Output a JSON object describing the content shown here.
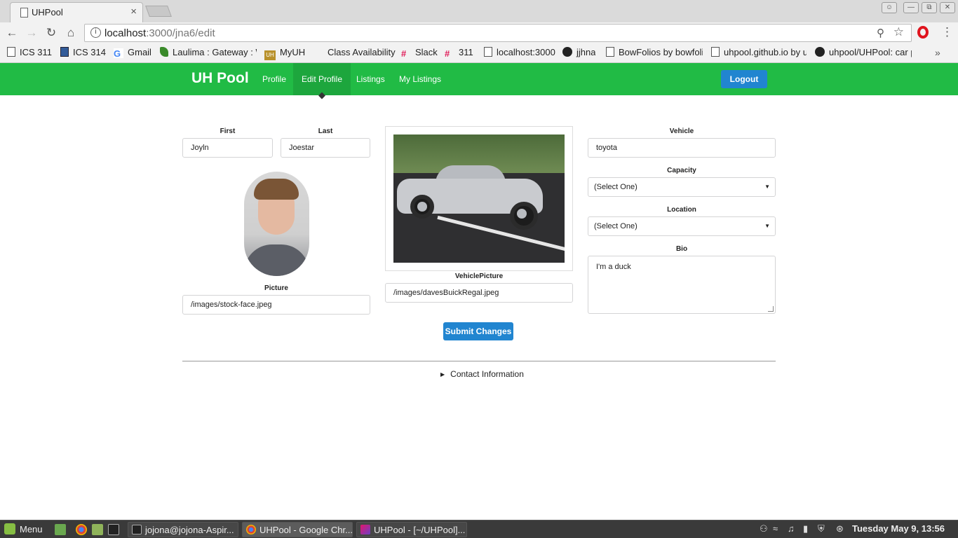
{
  "browser": {
    "tab_title": "UHPool",
    "tab_close": "×",
    "url_host": "localhost",
    "url_rest": ":3000/jna6/edit",
    "bookmarks": [
      {
        "label": "ICS 311",
        "icon": "page-icon"
      },
      {
        "label": "ICS 314",
        "icon": "blue-square-icon"
      },
      {
        "label": "Gmail",
        "icon": "google-icon"
      },
      {
        "label": "Laulima : Gateway : W",
        "icon": "laulima-icon"
      },
      {
        "label": "MyUH",
        "icon": "uh-icon"
      },
      {
        "label": "Class Availability",
        "icon": "blank-icon"
      },
      {
        "label": "Slack",
        "icon": "slack-icon"
      },
      {
        "label": "311",
        "icon": "slack-icon"
      },
      {
        "label": "localhost:3000",
        "icon": "page-icon"
      },
      {
        "label": "jjhna",
        "icon": "github-icon"
      },
      {
        "label": "BowFolios by bowfolio",
        "icon": "page-icon"
      },
      {
        "label": "uhpool.github.io by u",
        "icon": "page-icon"
      },
      {
        "label": "uhpool/UHPool: car p",
        "icon": "github-icon"
      }
    ],
    "more_bookmarks": "»"
  },
  "app": {
    "brand": "UH Pool",
    "nav": {
      "profile": "Profile",
      "edit_profile": "Edit Profile",
      "listings": "Listings",
      "my_listings": "My Listings"
    },
    "logout": "Logout",
    "accent": "#21bb45",
    "button_color": "#2185d0"
  },
  "form": {
    "first_label": "First",
    "first_value": "Joyln",
    "last_label": "Last",
    "last_value": "Joestar",
    "picture_label": "Picture",
    "picture_value": "/images/stock-face.jpeg",
    "vehicle_picture_label": "VehiclePicture",
    "vehicle_picture_value": "/images/davesBuickRegal.jpeg",
    "vehicle_label": "Vehicle",
    "vehicle_value": "toyota",
    "capacity_label": "Capacity",
    "capacity_value": "(Select One)",
    "location_label": "Location",
    "location_value": "(Select One)",
    "bio_label": "Bio",
    "bio_value": "I'm a duck",
    "submit": "Submit Changes",
    "contact_info": "Contact Information"
  },
  "taskbar": {
    "menu": "Menu",
    "tasks": [
      {
        "label": "jojona@jojona-Aspir...",
        "icon": "terminal-icon"
      },
      {
        "label": "UHPool - Google Chr...",
        "icon": "chrome-icon"
      },
      {
        "label": "UHPool - [~/UHPool]...",
        "icon": "intellij-icon"
      }
    ],
    "clock": "Tuesday May  9, 13:56"
  }
}
